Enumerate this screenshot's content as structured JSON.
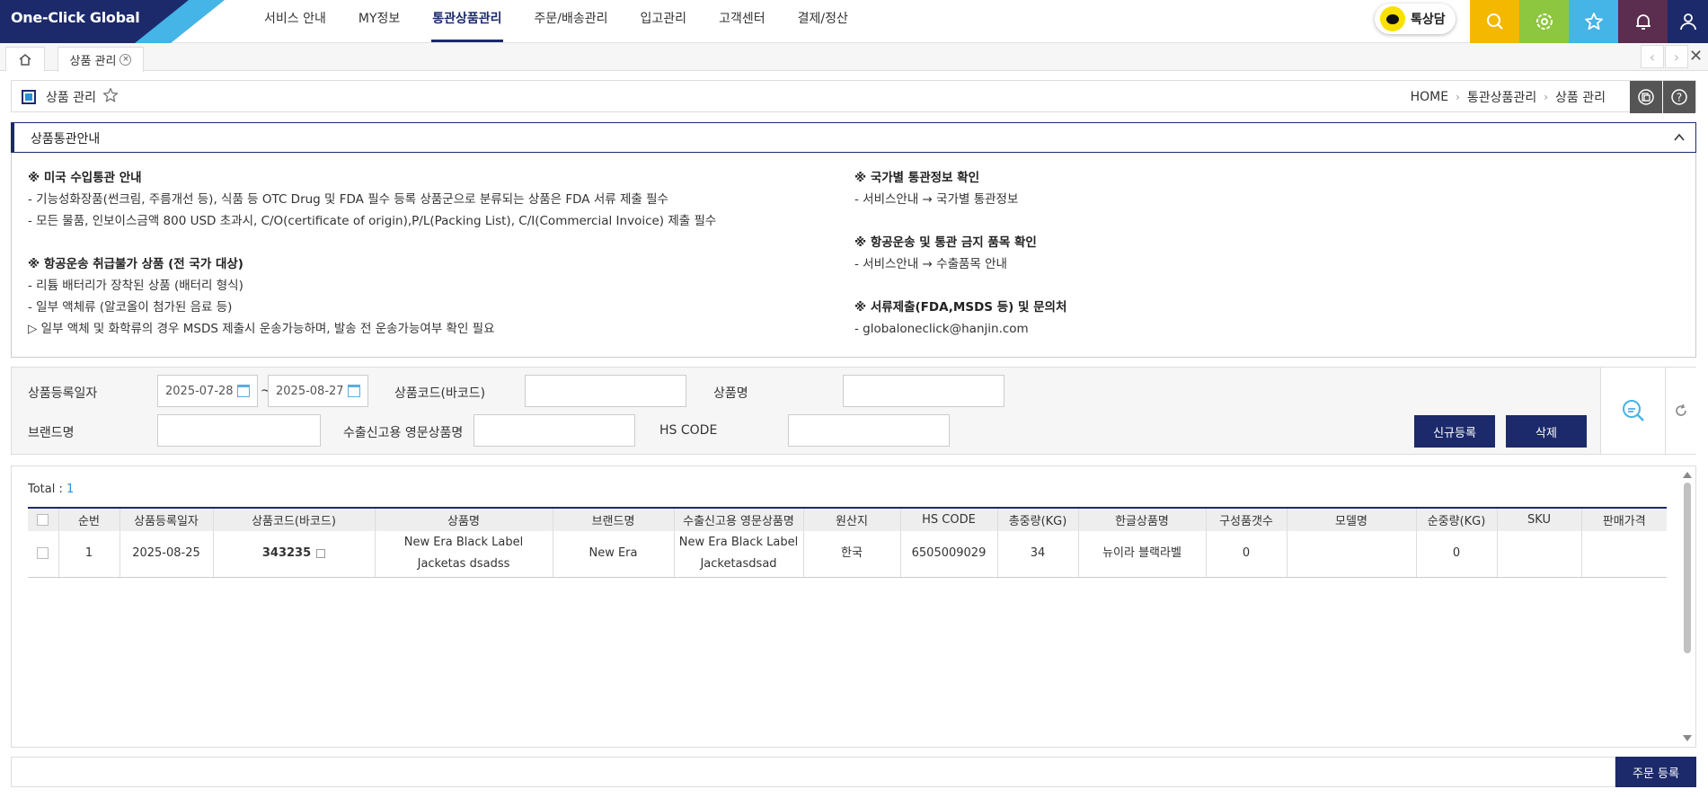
{
  "brand": {
    "logo_text": "One-Click Global"
  },
  "nav": {
    "items": [
      {
        "label": "서비스 안내",
        "active": false
      },
      {
        "label": "MY정보",
        "active": false
      },
      {
        "label": "통관상품관리",
        "active": true
      },
      {
        "label": "주문/배송관리",
        "active": false
      },
      {
        "label": "입고관리",
        "active": false
      },
      {
        "label": "고객센터",
        "active": false
      },
      {
        "label": "결제/정산",
        "active": false
      }
    ],
    "talk_label": "톡상담",
    "icons": [
      {
        "name": "search-icon",
        "color": "#f5b800"
      },
      {
        "name": "gear-icon",
        "color": "#8dc63f"
      },
      {
        "name": "star-icon",
        "color": "#45b4e6"
      },
      {
        "name": "bell-icon",
        "color": "#5b2d4f"
      },
      {
        "name": "user-icon",
        "color": "#1c2a6b"
      }
    ]
  },
  "tabs": {
    "current": "상품 관리"
  },
  "page": {
    "title": "상품 관리",
    "breadcrumb": [
      "HOME",
      "통관상품관리",
      "상품 관리"
    ]
  },
  "info": {
    "header": "상품통관안내",
    "left": {
      "s1_title": "※ 미국 수입통관 안내",
      "s1_l1": "- 기능성화장품(썬크림, 주름개선 등), 식품 등 OTC Drug 및 FDA 필수 등록 상품군으로 분류되는 상품은 FDA 서류 제출 필수",
      "s1_l2": "- 모든 물품, 인보이스금액 800 USD 초과시, C/O(certificate of origin),P/L(Packing List), C/I(Commercial Invoice) 제출 필수",
      "s2_title": "※ 항공운송 취급불가 상품 (전 국가 대상)",
      "s2_l1": "- 리튬 배터리가 장착된 상품 (배터리 형식)",
      "s2_l2": "- 일부 액체류 (알코올이 첨가된 음료 등)",
      "s2_l3": "▷ 일부 액체 및 화학류의 경우 MSDS 제출시 운송가능하며, 발송 전 운송가능여부 확인 필요"
    },
    "right": {
      "s1_title": "※ 국가별 통관정보 확인",
      "s1_l1": "- 서비스안내 → 국가별 통관정보",
      "s2_title": "※ 항공운송 및 통관 금지 품목 확인",
      "s2_l1": "- 서비스안내 → 수출품목 안내",
      "s3_title": "※ 서류제출(FDA,MSDS 등) 및 문의처",
      "s3_l1": "- globaloneclick@hanjin.com"
    }
  },
  "search": {
    "date_label": "상품등록일자",
    "date_from": "2025-07-28",
    "date_sep": "~",
    "date_to": "2025-08-27",
    "code_label": "상품코드(바코드)",
    "name_label": "상품명",
    "brand_label": "브랜드명",
    "export_name_label": "수출신고용 영문상품명",
    "hs_label": "HS CODE",
    "new_button": "신규등록",
    "delete_button": "삭제"
  },
  "grid": {
    "total_label": "Total : ",
    "total_count": "1",
    "columns": [
      "순번",
      "상품등록일자",
      "상품코드(바코드)",
      "상품명",
      "브랜드명",
      "수출신고용 영문상품명",
      "원산지",
      "HS CODE",
      "총중량(KG)",
      "한글상품명",
      "구성품갯수",
      "모델명",
      "순중량(KG)",
      "SKU",
      "판매가격"
    ],
    "rows": [
      {
        "no": "1",
        "reg_date": "2025-08-25",
        "code": "343235",
        "name": "New Era Black Label Jacketas dsadss",
        "brand": "New Era",
        "export_name": "New Era Black Label Jacketasdsad",
        "origin": "한국",
        "hs_code": "6505009029",
        "gross_weight": "34",
        "kr_name": "뉴이라 블랙라벨",
        "components": "0",
        "model": "",
        "net_weight": "0",
        "sku": "",
        "price": ""
      }
    ]
  },
  "bottom": {
    "order_button": "주문 등록"
  }
}
